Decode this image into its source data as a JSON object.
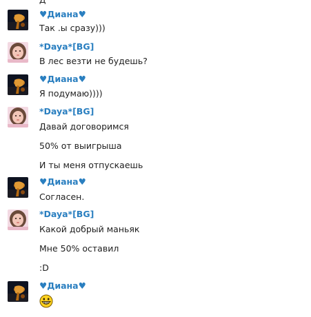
{
  "clipped_top_text": "Д",
  "messages": [
    {
      "author": "♥Диана♥",
      "avatar": "diana-avatar",
      "lines": [
        "Так .ы сразу)))"
      ]
    },
    {
      "author": "*Daya*[BG]",
      "avatar": "daya-avatar",
      "lines": [
        "В лес везти не будешь?"
      ]
    },
    {
      "author": "♥Диана♥",
      "avatar": "diana-avatar",
      "lines": [
        "Я подумаю))))"
      ]
    },
    {
      "author": "*Daya*[BG]",
      "avatar": "daya-avatar",
      "lines": [
        "Давай договоримся",
        "50% от выигрыша",
        "И ты меня отпускаешь"
      ]
    },
    {
      "author": "♥Диана♥",
      "avatar": "diana-avatar",
      "lines": [
        "Согласен."
      ]
    },
    {
      "author": "*Daya*[BG]",
      "avatar": "daya-avatar",
      "lines": [
        "Какой добрый маньяк",
        "Мне 50% оставил",
        ":D"
      ]
    },
    {
      "author": "♥Диана♥",
      "avatar": "diana-avatar",
      "lines": [],
      "emoji": "grinning-face-emoji"
    }
  ],
  "colors": {
    "author": "#2a7fc0",
    "text": "#1e1e1e",
    "background": "#ffffff"
  }
}
